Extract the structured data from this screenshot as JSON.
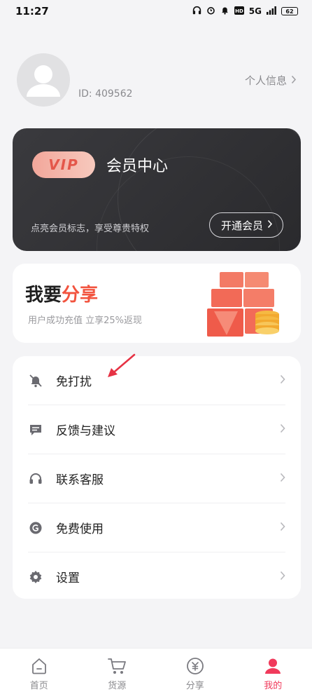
{
  "status_bar": {
    "time": "11:27",
    "network_label": "5G",
    "battery_label": "62"
  },
  "profile": {
    "user_id": "ID:  409562",
    "personal_info_label": "个人信息"
  },
  "vip": {
    "badge": "VIP",
    "title": "会员中心",
    "subtitle": "点亮会员标志，享受尊贵特权",
    "open_button": "开通会员"
  },
  "share": {
    "title_main": "我要",
    "title_accent": "分享",
    "description": "用户成功充值 立享25%返现"
  },
  "menu": {
    "items": [
      {
        "label": "免打扰",
        "icon": "bell-off-icon"
      },
      {
        "label": "反馈与建议",
        "icon": "feedback-icon"
      },
      {
        "label": "联系客服",
        "icon": "headset-icon"
      },
      {
        "label": "免费使用",
        "icon": "coin-icon"
      },
      {
        "label": "设置",
        "icon": "gear-icon"
      }
    ]
  },
  "tabs": [
    {
      "label": "首页",
      "icon": "home-icon",
      "active": false
    },
    {
      "label": "货源",
      "icon": "cart-icon",
      "active": false
    },
    {
      "label": "分享",
      "icon": "share-coin-icon",
      "active": false
    },
    {
      "label": "我的",
      "icon": "user-icon",
      "active": true
    }
  ],
  "colors": {
    "accent": "#f03a5b",
    "share_accent": "#f2543f",
    "vip_card": "#2f2f33",
    "vip_badge_text": "#e4574a"
  }
}
